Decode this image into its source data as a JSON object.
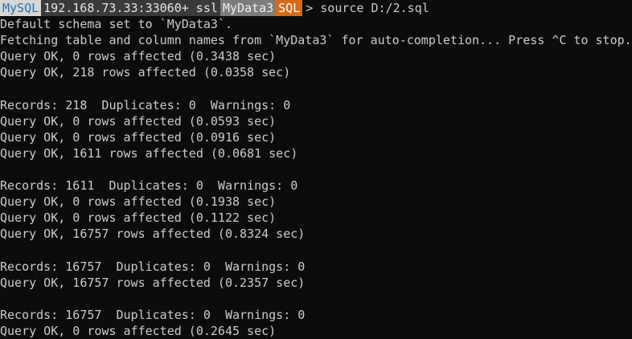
{
  "prompt": {
    "app": "MySQL",
    "host": "192.168.73.33:33060+ ssl",
    "database": "MyData3",
    "mode": "SQL",
    "command": "> source D:/2.sql"
  },
  "output": {
    "l1": "Default schema set to `MyData3`.",
    "l2": "Fetching table and column names from `MyData3` for auto-completion... Press ^C to stop.",
    "l3": "Query OK, 0 rows affected (0.3438 sec)",
    "l4": "Query OK, 218 rows affected (0.0358 sec)",
    "l6": "Records: 218  Duplicates: 0  Warnings: 0",
    "l7": "Query OK, 0 rows affected (0.0593 sec)",
    "l8": "Query OK, 0 rows affected (0.0916 sec)",
    "l9": "Query OK, 1611 rows affected (0.0681 sec)",
    "l11": "Records: 1611  Duplicates: 0  Warnings: 0",
    "l12": "Query OK, 0 rows affected (0.1938 sec)",
    "l13": "Query OK, 0 rows affected (0.1122 sec)",
    "l14": "Query OK, 16757 rows affected (0.8324 sec)",
    "l16": "Records: 16757  Duplicates: 0  Warnings: 0",
    "l17": "Query OK, 16757 rows affected (0.2357 sec)",
    "l19": "Records: 16757  Duplicates: 0  Warnings: 0",
    "l20": "Query OK, 0 rows affected (0.2645 sec)"
  },
  "colors": {
    "background": "#0c0c0c",
    "text": "#cccccc",
    "mysql_segment_bg": "#d6d6d6",
    "mysql_segment_fg": "#2a72a8",
    "host_segment_bg": "#3a3a3a",
    "db_segment_bg": "#7d7d7d",
    "mode_segment_bg": "#d86a17"
  }
}
